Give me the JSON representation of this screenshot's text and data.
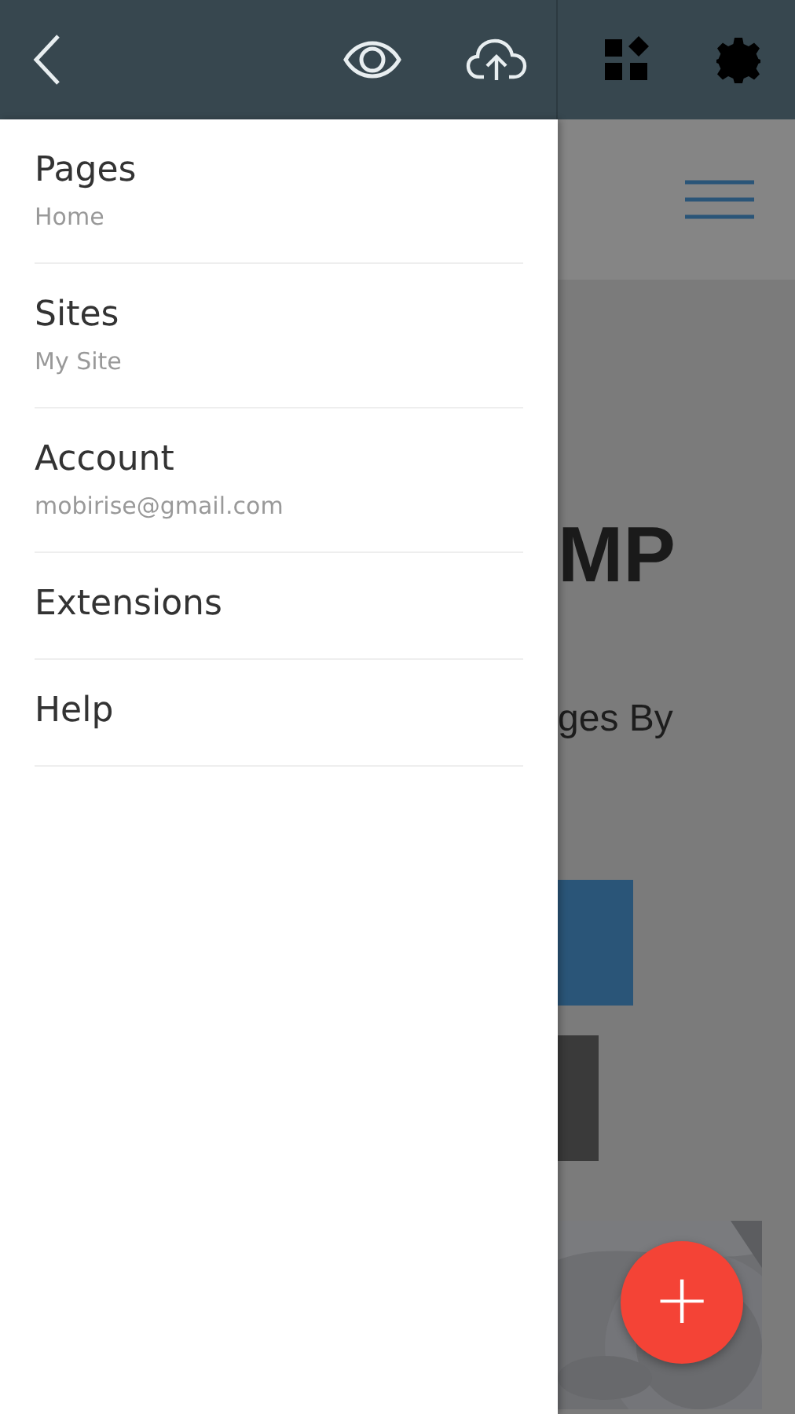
{
  "drawer": {
    "items": [
      {
        "title": "Pages",
        "subtitle": "Home"
      },
      {
        "title": "Sites",
        "subtitle": "My Site"
      },
      {
        "title": "Account",
        "subtitle": "mobirise@gmail.com"
      },
      {
        "title": "Extensions"
      },
      {
        "title": "Help"
      }
    ]
  },
  "page_behind": {
    "headline": "MP",
    "text": "ges By"
  },
  "fab": {
    "label": "+"
  }
}
